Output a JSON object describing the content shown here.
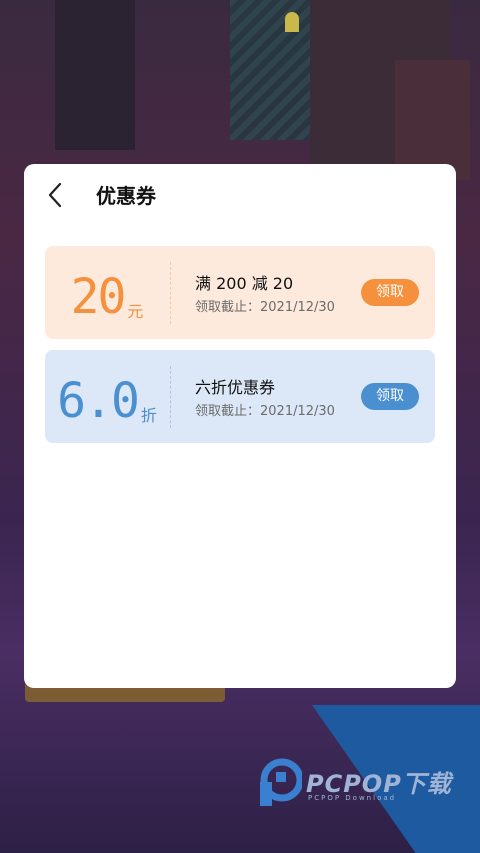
{
  "header": {
    "title": "优惠券"
  },
  "coupons": [
    {
      "amount": "20",
      "unit": "元",
      "name": "满 200 减 20",
      "expiry": "领取截止：2021/12/30",
      "button": "领取",
      "color": "#f5903c"
    },
    {
      "amount": "6.0",
      "unit": "折",
      "name": "六折优惠券",
      "expiry": "领取截止：2021/12/30",
      "button": "领取",
      "color": "#4a8fcf"
    }
  ],
  "watermark": {
    "brand": "PCPOP下载",
    "sub": "PCPOP Download"
  },
  "icons": {
    "back": "chevron-left-icon"
  }
}
